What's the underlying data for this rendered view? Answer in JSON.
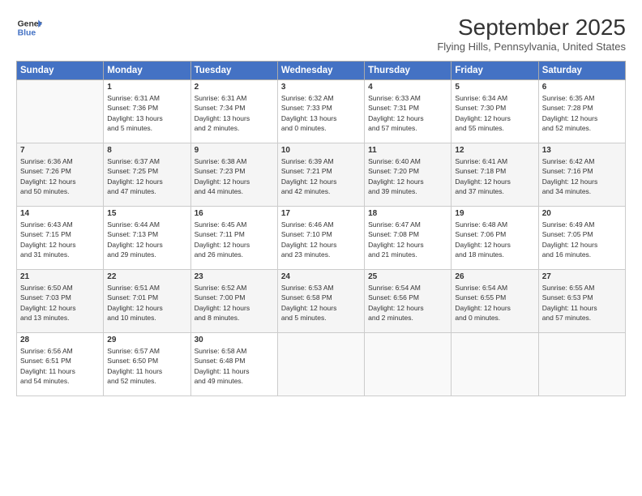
{
  "logo": {
    "line1": "General",
    "line2": "Blue"
  },
  "title": "September 2025",
  "location": "Flying Hills, Pennsylvania, United States",
  "days_header": [
    "Sunday",
    "Monday",
    "Tuesday",
    "Wednesday",
    "Thursday",
    "Friday",
    "Saturday"
  ],
  "weeks": [
    [
      {
        "day": "",
        "sunrise": "",
        "sunset": "",
        "daylight": ""
      },
      {
        "day": "1",
        "sunrise": "Sunrise: 6:31 AM",
        "sunset": "Sunset: 7:36 PM",
        "daylight": "Daylight: 13 hours and 5 minutes."
      },
      {
        "day": "2",
        "sunrise": "Sunrise: 6:31 AM",
        "sunset": "Sunset: 7:34 PM",
        "daylight": "Daylight: 13 hours and 2 minutes."
      },
      {
        "day": "3",
        "sunrise": "Sunrise: 6:32 AM",
        "sunset": "Sunset: 7:33 PM",
        "daylight": "Daylight: 13 hours and 0 minutes."
      },
      {
        "day": "4",
        "sunrise": "Sunrise: 6:33 AM",
        "sunset": "Sunset: 7:31 PM",
        "daylight": "Daylight: 12 hours and 57 minutes."
      },
      {
        "day": "5",
        "sunrise": "Sunrise: 6:34 AM",
        "sunset": "Sunset: 7:30 PM",
        "daylight": "Daylight: 12 hours and 55 minutes."
      },
      {
        "day": "6",
        "sunrise": "Sunrise: 6:35 AM",
        "sunset": "Sunset: 7:28 PM",
        "daylight": "Daylight: 12 hours and 52 minutes."
      }
    ],
    [
      {
        "day": "7",
        "sunrise": "Sunrise: 6:36 AM",
        "sunset": "Sunset: 7:26 PM",
        "daylight": "Daylight: 12 hours and 50 minutes."
      },
      {
        "day": "8",
        "sunrise": "Sunrise: 6:37 AM",
        "sunset": "Sunset: 7:25 PM",
        "daylight": "Daylight: 12 hours and 47 minutes."
      },
      {
        "day": "9",
        "sunrise": "Sunrise: 6:38 AM",
        "sunset": "Sunset: 7:23 PM",
        "daylight": "Daylight: 12 hours and 44 minutes."
      },
      {
        "day": "10",
        "sunrise": "Sunrise: 6:39 AM",
        "sunset": "Sunset: 7:21 PM",
        "daylight": "Daylight: 12 hours and 42 minutes."
      },
      {
        "day": "11",
        "sunrise": "Sunrise: 6:40 AM",
        "sunset": "Sunset: 7:20 PM",
        "daylight": "Daylight: 12 hours and 39 minutes."
      },
      {
        "day": "12",
        "sunrise": "Sunrise: 6:41 AM",
        "sunset": "Sunset: 7:18 PM",
        "daylight": "Daylight: 12 hours and 37 minutes."
      },
      {
        "day": "13",
        "sunrise": "Sunrise: 6:42 AM",
        "sunset": "Sunset: 7:16 PM",
        "daylight": "Daylight: 12 hours and 34 minutes."
      }
    ],
    [
      {
        "day": "14",
        "sunrise": "Sunrise: 6:43 AM",
        "sunset": "Sunset: 7:15 PM",
        "daylight": "Daylight: 12 hours and 31 minutes."
      },
      {
        "day": "15",
        "sunrise": "Sunrise: 6:44 AM",
        "sunset": "Sunset: 7:13 PM",
        "daylight": "Daylight: 12 hours and 29 minutes."
      },
      {
        "day": "16",
        "sunrise": "Sunrise: 6:45 AM",
        "sunset": "Sunset: 7:11 PM",
        "daylight": "Daylight: 12 hours and 26 minutes."
      },
      {
        "day": "17",
        "sunrise": "Sunrise: 6:46 AM",
        "sunset": "Sunset: 7:10 PM",
        "daylight": "Daylight: 12 hours and 23 minutes."
      },
      {
        "day": "18",
        "sunrise": "Sunrise: 6:47 AM",
        "sunset": "Sunset: 7:08 PM",
        "daylight": "Daylight: 12 hours and 21 minutes."
      },
      {
        "day": "19",
        "sunrise": "Sunrise: 6:48 AM",
        "sunset": "Sunset: 7:06 PM",
        "daylight": "Daylight: 12 hours and 18 minutes."
      },
      {
        "day": "20",
        "sunrise": "Sunrise: 6:49 AM",
        "sunset": "Sunset: 7:05 PM",
        "daylight": "Daylight: 12 hours and 16 minutes."
      }
    ],
    [
      {
        "day": "21",
        "sunrise": "Sunrise: 6:50 AM",
        "sunset": "Sunset: 7:03 PM",
        "daylight": "Daylight: 12 hours and 13 minutes."
      },
      {
        "day": "22",
        "sunrise": "Sunrise: 6:51 AM",
        "sunset": "Sunset: 7:01 PM",
        "daylight": "Daylight: 12 hours and 10 minutes."
      },
      {
        "day": "23",
        "sunrise": "Sunrise: 6:52 AM",
        "sunset": "Sunset: 7:00 PM",
        "daylight": "Daylight: 12 hours and 8 minutes."
      },
      {
        "day": "24",
        "sunrise": "Sunrise: 6:53 AM",
        "sunset": "Sunset: 6:58 PM",
        "daylight": "Daylight: 12 hours and 5 minutes."
      },
      {
        "day": "25",
        "sunrise": "Sunrise: 6:54 AM",
        "sunset": "Sunset: 6:56 PM",
        "daylight": "Daylight: 12 hours and 2 minutes."
      },
      {
        "day": "26",
        "sunrise": "Sunrise: 6:54 AM",
        "sunset": "Sunset: 6:55 PM",
        "daylight": "Daylight: 12 hours and 0 minutes."
      },
      {
        "day": "27",
        "sunrise": "Sunrise: 6:55 AM",
        "sunset": "Sunset: 6:53 PM",
        "daylight": "Daylight: 11 hours and 57 minutes."
      }
    ],
    [
      {
        "day": "28",
        "sunrise": "Sunrise: 6:56 AM",
        "sunset": "Sunset: 6:51 PM",
        "daylight": "Daylight: 11 hours and 54 minutes."
      },
      {
        "day": "29",
        "sunrise": "Sunrise: 6:57 AM",
        "sunset": "Sunset: 6:50 PM",
        "daylight": "Daylight: 11 hours and 52 minutes."
      },
      {
        "day": "30",
        "sunrise": "Sunrise: 6:58 AM",
        "sunset": "Sunset: 6:48 PM",
        "daylight": "Daylight: 11 hours and 49 minutes."
      },
      {
        "day": "",
        "sunrise": "",
        "sunset": "",
        "daylight": ""
      },
      {
        "day": "",
        "sunrise": "",
        "sunset": "",
        "daylight": ""
      },
      {
        "day": "",
        "sunrise": "",
        "sunset": "",
        "daylight": ""
      },
      {
        "day": "",
        "sunrise": "",
        "sunset": "",
        "daylight": ""
      }
    ]
  ]
}
